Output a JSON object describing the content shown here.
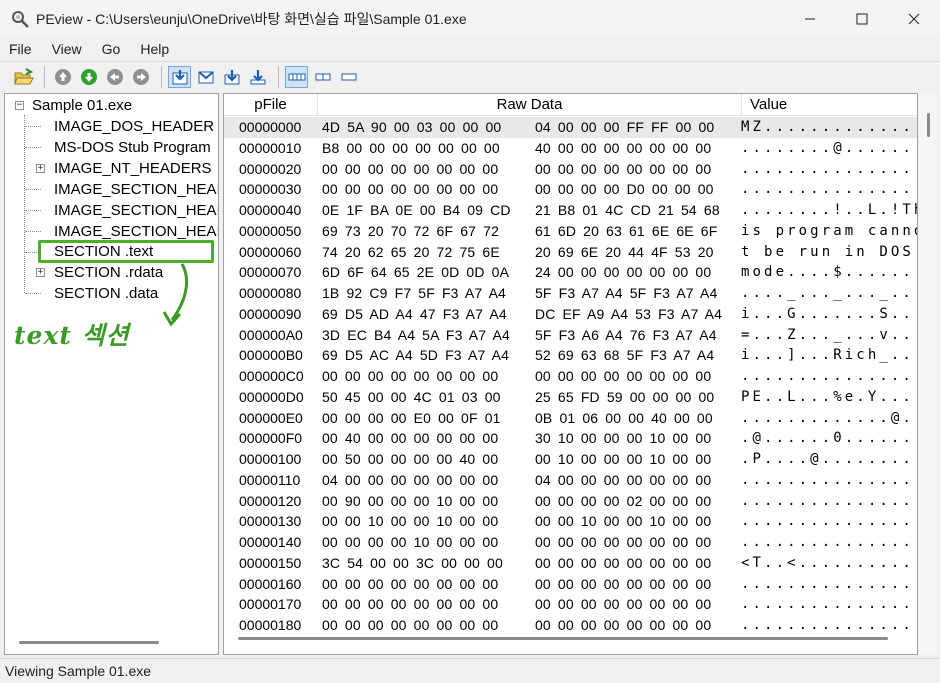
{
  "window": {
    "title": "PEview - C:\\Users\\eunju\\OneDrive\\바탕 화면\\실습 파일\\Sample 01.exe"
  },
  "menu": [
    "File",
    "View",
    "Go",
    "Help"
  ],
  "tree": {
    "root": "Sample 01.exe",
    "items": [
      "IMAGE_DOS_HEADER",
      "MS-DOS Stub Program",
      "IMAGE_NT_HEADERS",
      "IMAGE_SECTION_HEAI",
      "IMAGE_SECTION_HEAI",
      "IMAGE_SECTION_HEAI",
      "SECTION .text",
      "SECTION .rdata",
      "SECTION .data"
    ]
  },
  "annotation": {
    "text": "text 섹션",
    "color": "#3d9a25"
  },
  "grid": {
    "columns": [
      "pFile",
      "Raw Data",
      "Value"
    ],
    "rows": [
      {
        "off": "00000000",
        "h1": "4D 5A 90 00 03 00 00 00",
        "h2": "04 00 00 00 FF FF 00 00",
        "v": "MZ.............."
      },
      {
        "off": "00000010",
        "h1": "B8 00 00 00 00 00 00 00",
        "h2": "40 00 00 00 00 00 00 00",
        "v": "........@......."
      },
      {
        "off": "00000020",
        "h1": "00 00 00 00 00 00 00 00",
        "h2": "00 00 00 00 00 00 00 00",
        "v": "................"
      },
      {
        "off": "00000030",
        "h1": "00 00 00 00 00 00 00 00",
        "h2": "00 00 00 00 D0 00 00 00",
        "v": "................"
      },
      {
        "off": "00000040",
        "h1": "0E 1F BA 0E 00 B4 09 CD",
        "h2": "21 B8 01 4C CD 21 54 68",
        "v": "........!..L.!Th"
      },
      {
        "off": "00000050",
        "h1": "69 73 20 70 72 6F 67 72",
        "h2": "61 6D 20 63 61 6E 6E 6F",
        "v": "is program canno"
      },
      {
        "off": "00000060",
        "h1": "74 20 62 65 20 72 75 6E",
        "h2": "20 69 6E 20 44 4F 53 20",
        "v": "t be run in DOS "
      },
      {
        "off": "00000070",
        "h1": "6D 6F 64 65 2E 0D 0D 0A",
        "h2": "24 00 00 00 00 00 00 00",
        "v": "mode....$......."
      },
      {
        "off": "00000080",
        "h1": "1B 92 C9 F7 5F F3 A7 A4",
        "h2": "5F F3 A7 A4 5F F3 A7 A4",
        "v": "...._..._..._..."
      },
      {
        "off": "00000090",
        "h1": "69 D5 AD A4 47 F3 A7 A4",
        "h2": "DC EF A9 A4 53 F3 A7 A4",
        "v": "i...G.......S..."
      },
      {
        "off": "000000A0",
        "h1": "3D EC B4 A4 5A F3 A7 A4",
        "h2": "5F F3 A6 A4 76 F3 A7 A4",
        "v": "=...Z..._...v..."
      },
      {
        "off": "000000B0",
        "h1": "69 D5 AC A4 5D F3 A7 A4",
        "h2": "52 69 63 68 5F F3 A7 A4",
        "v": "i...]...Rich_..."
      },
      {
        "off": "000000C0",
        "h1": "00 00 00 00 00 00 00 00",
        "h2": "00 00 00 00 00 00 00 00",
        "v": "................"
      },
      {
        "off": "000000D0",
        "h1": "50 45 00 00 4C 01 03 00",
        "h2": "25 65 FD 59 00 00 00 00",
        "v": "PE..L...%e.Y...."
      },
      {
        "off": "000000E0",
        "h1": "00 00 00 00 E0 00 0F 01",
        "h2": "0B 01 06 00 00 40 00 00",
        "v": ".............@.."
      },
      {
        "off": "000000F0",
        "h1": "00 40 00 00 00 00 00 00",
        "h2": "30 10 00 00 00 10 00 00",
        "v": ".@......0......."
      },
      {
        "off": "00000100",
        "h1": "00 50 00 00 00 00 40 00",
        "h2": "00 10 00 00 00 10 00 00",
        "v": ".P....@........."
      },
      {
        "off": "00000110",
        "h1": "04 00 00 00 00 00 00 00",
        "h2": "04 00 00 00 00 00 00 00",
        "v": "................"
      },
      {
        "off": "00000120",
        "h1": "00 90 00 00 00 10 00 00",
        "h2": "00 00 00 00 02 00 00 00",
        "v": "................"
      },
      {
        "off": "00000130",
        "h1": "00 00 10 00 00 10 00 00",
        "h2": "00 00 10 00 00 10 00 00",
        "v": "................"
      },
      {
        "off": "00000140",
        "h1": "00 00 00 00 10 00 00 00",
        "h2": "00 00 00 00 00 00 00 00",
        "v": "................"
      },
      {
        "off": "00000150",
        "h1": "3C 54 00 00 3C 00 00 00",
        "h2": "00 00 00 00 00 00 00 00",
        "v": "<T..<..........."
      },
      {
        "off": "00000160",
        "h1": "00 00 00 00 00 00 00 00",
        "h2": "00 00 00 00 00 00 00 00",
        "v": "................"
      },
      {
        "off": "00000170",
        "h1": "00 00 00 00 00 00 00 00",
        "h2": "00 00 00 00 00 00 00 00",
        "v": "................"
      },
      {
        "off": "00000180",
        "h1": "00 00 00 00 00 00 00 00",
        "h2": "00 00 00 00 00 00 00 00",
        "v": "................"
      }
    ]
  },
  "status": "Viewing Sample 01.exe"
}
